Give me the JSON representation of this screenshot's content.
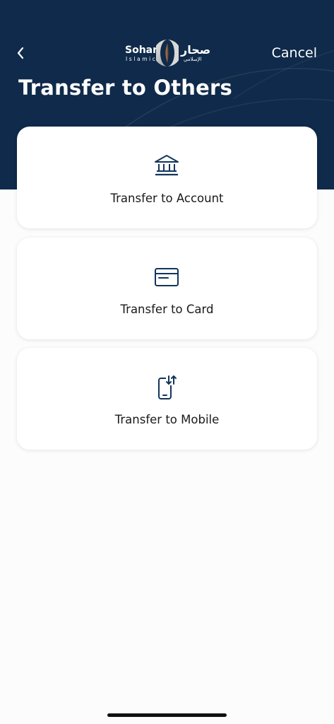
{
  "header": {
    "cancel_label": "Cancel",
    "title": "Transfer to Others",
    "logo": {
      "name_en": "Sohar",
      "sub_en": "Islamic",
      "name_ar": "صحار",
      "sub_ar": "الإسلامي"
    }
  },
  "options": [
    {
      "label": "Transfer to Account",
      "icon": "bank-icon"
    },
    {
      "label": "Transfer to Card",
      "icon": "card-icon"
    },
    {
      "label": "Transfer to Mobile",
      "icon": "mobile-transfer-icon"
    }
  ],
  "colors": {
    "header_bg": "#0f2a4a",
    "icon": "#12355b",
    "page_bg": "#fcfcfc",
    "card_bg": "#ffffff"
  }
}
